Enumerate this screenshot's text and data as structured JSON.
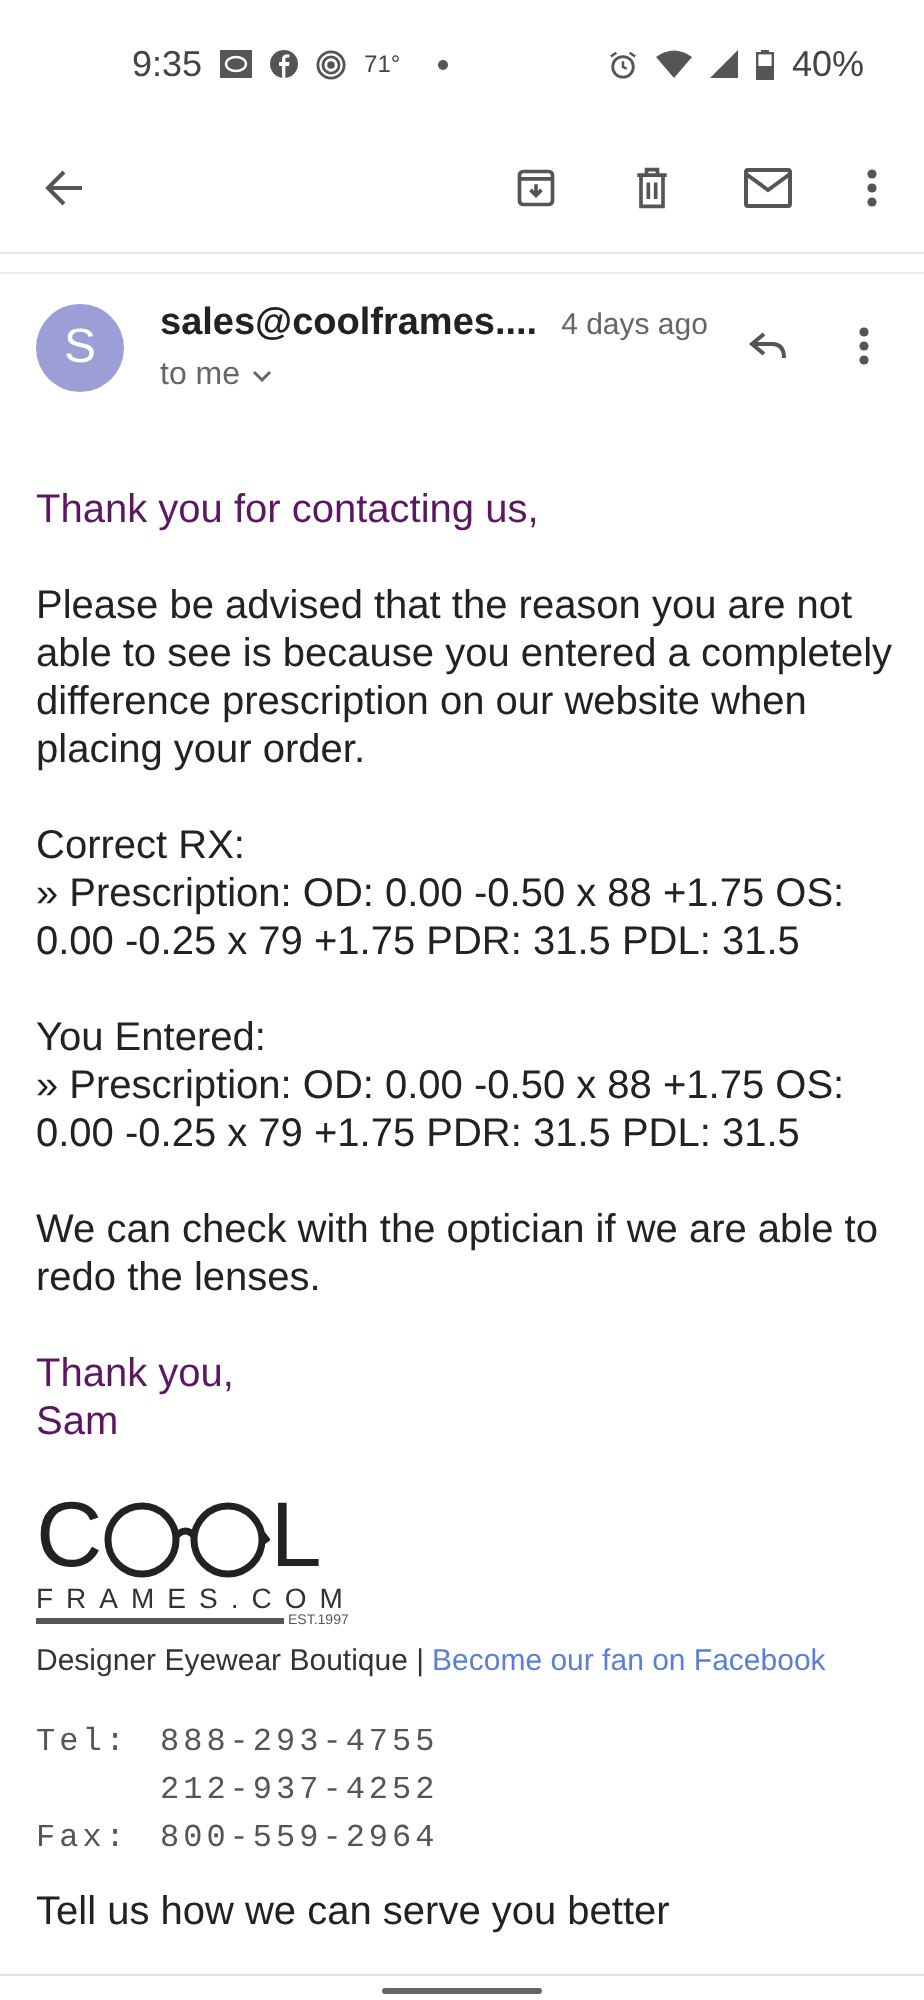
{
  "status_bar": {
    "time": "9:35",
    "temperature": "71°",
    "battery": "40%"
  },
  "toolbar": {
    "actions": [
      {
        "kind": "archive"
      },
      {
        "kind": "delete"
      },
      {
        "kind": "unread"
      },
      {
        "kind": "more"
      }
    ]
  },
  "message": {
    "avatar": "S",
    "sender": "sales@coolframes....",
    "time": "4 days ago",
    "recipient": "to me",
    "paragraphs": [
      {
        "kind": "greeting",
        "lines": [
          "Thank you for contacting us,"
        ]
      },
      {
        "kind": "body",
        "lines": [
          "Please be advised that the reason you are not able to see is because you entered a completely difference prescription on our website when placing your order."
        ]
      },
      {
        "kind": "body",
        "lines": [
          "Correct RX:",
          "» Prescription: OD: 0.00 -0.50 x 88 +1.75 OS: 0.00 -0.25 x 79 +1.75 PDR: 31.5 PDL: 31.5"
        ]
      },
      {
        "kind": "body",
        "lines": [
          "You Entered:",
          "» Prescription: OD: 0.00 -0.50 x 88 +1.75 OS: 0.00 -0.25 x 79 +1.75 PDR: 31.5 PDL: 31.5"
        ]
      },
      {
        "kind": "body",
        "lines": [
          "We can check with the optician if we are able to redo the lenses."
        ]
      },
      {
        "kind": "signoff",
        "lines": [
          "Thank you,",
          "Sam"
        ]
      }
    ],
    "logo": {
      "first_letter": "C",
      "last_letter": "L",
      "wordmark": "FRAMES.COM",
      "established": "EST.1997"
    },
    "tagline": "Designer Eyewear Boutique |",
    "facebook_link": "Become our fan on Facebook",
    "contacts": [
      {
        "label": "Tel:",
        "number": "888-293-4755"
      },
      {
        "number": "212-937-4252"
      },
      {
        "label": "Fax:",
        "number": "800-559-2964"
      }
    ],
    "closing": "Tell us how we can serve you better"
  }
}
